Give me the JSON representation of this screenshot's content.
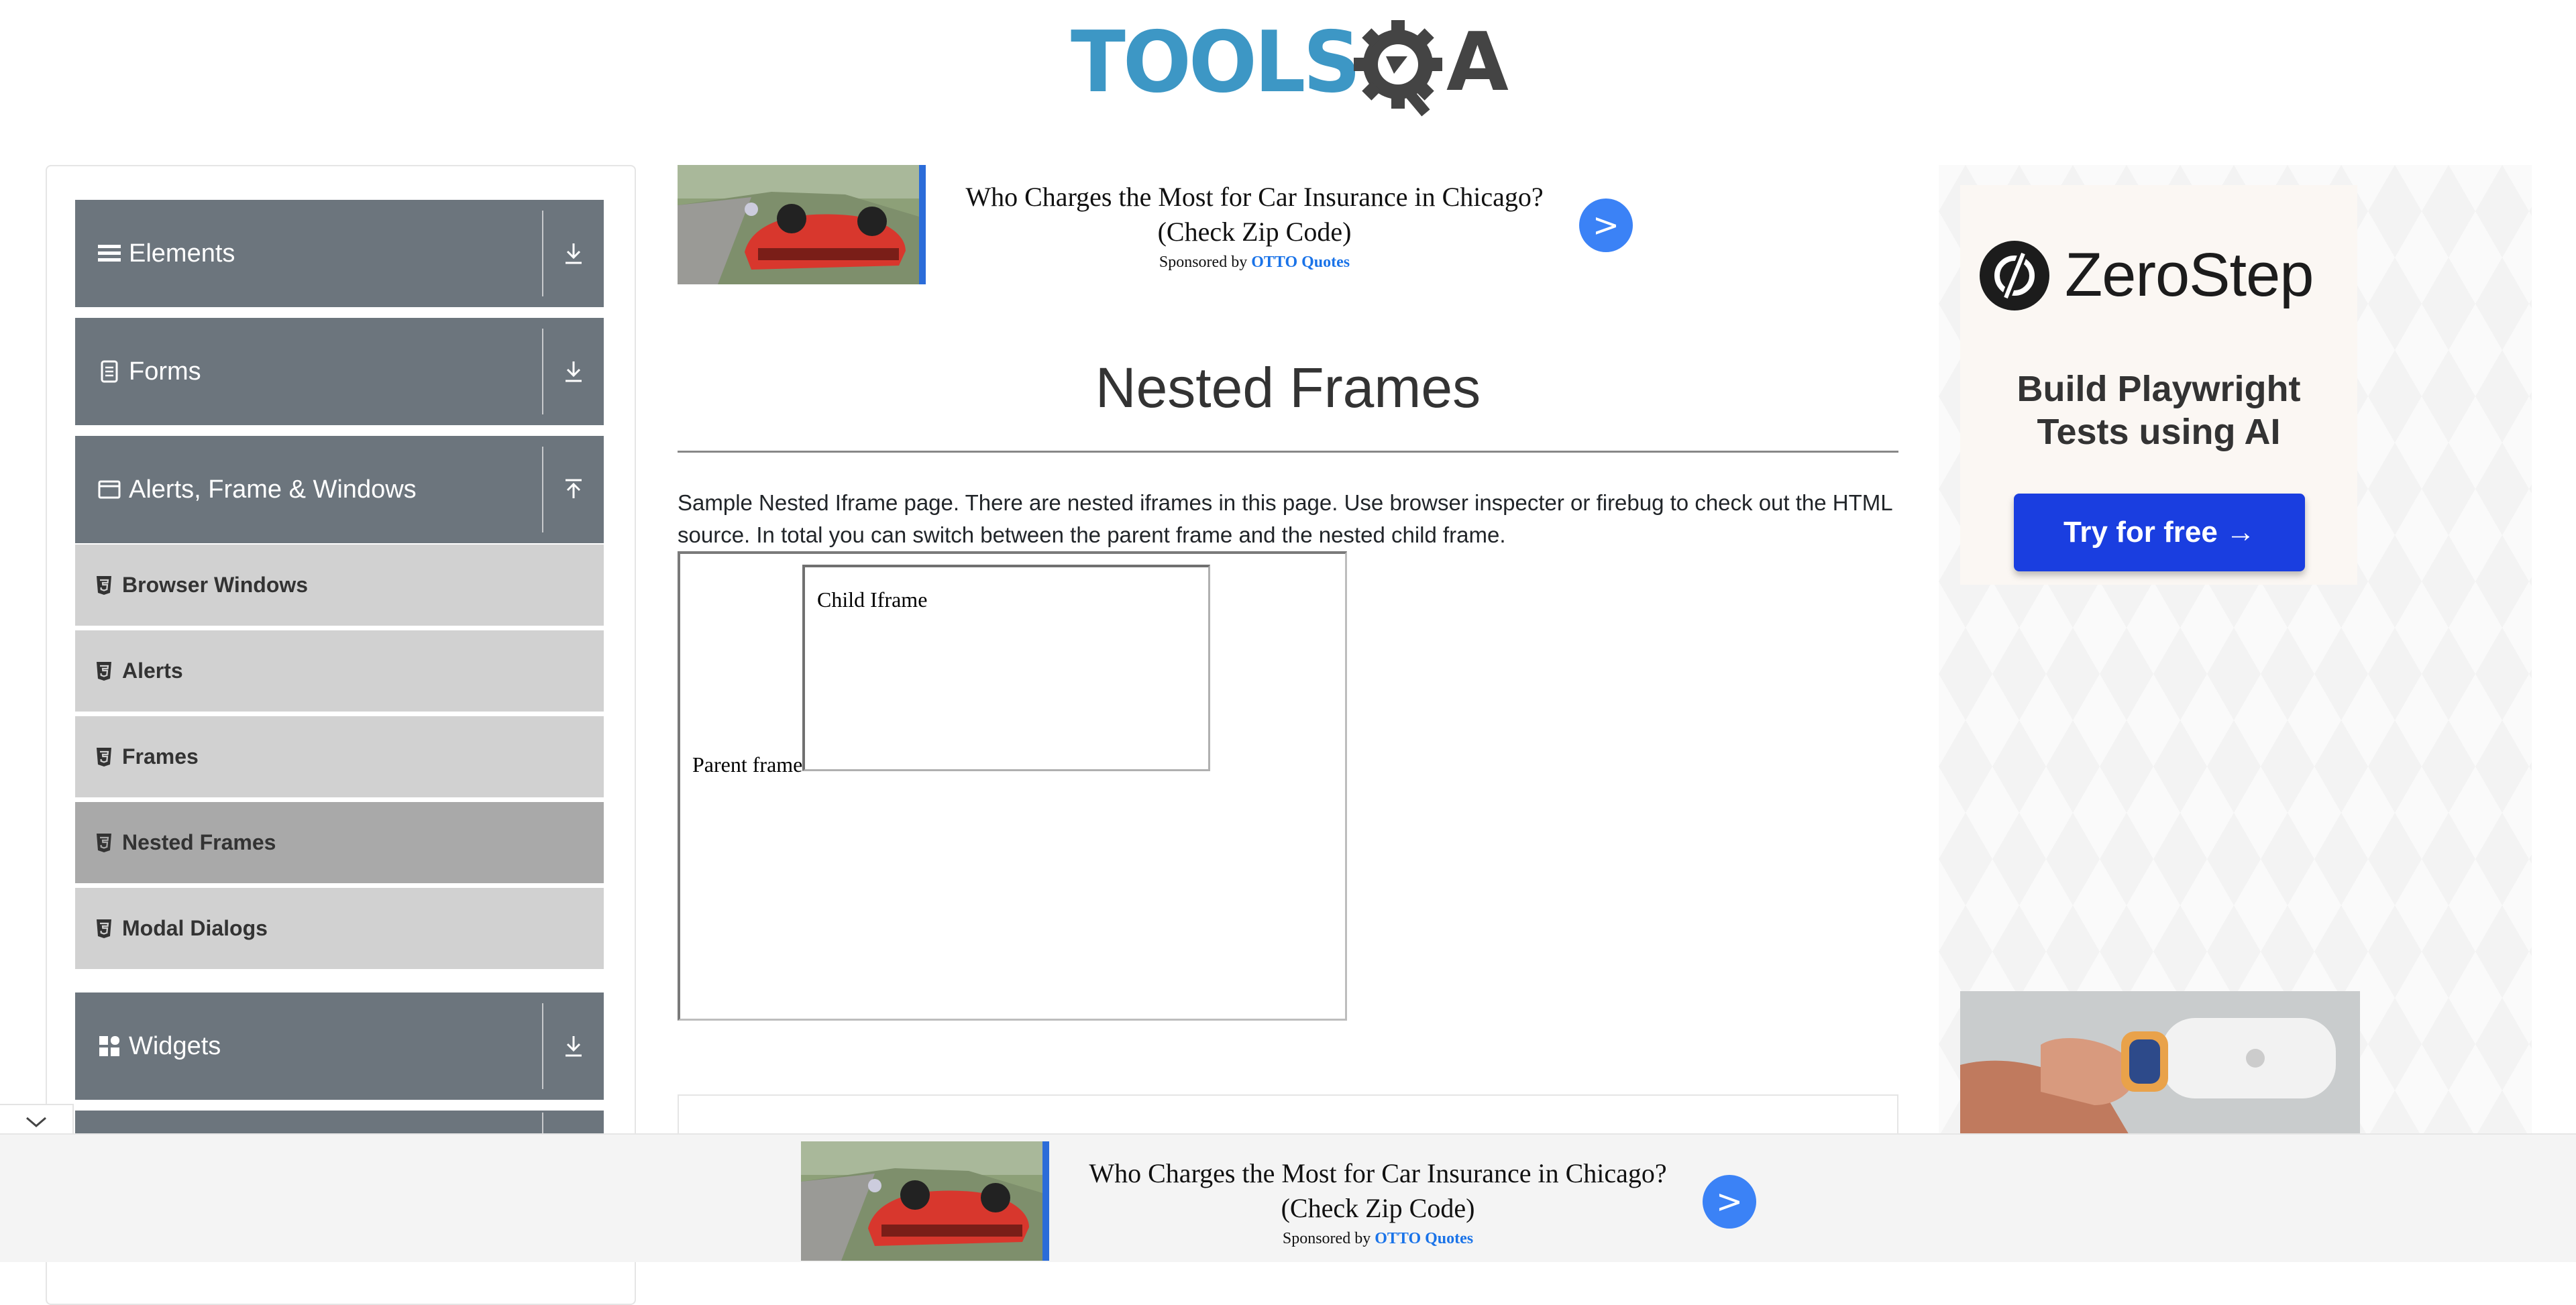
{
  "logo": {
    "brand": "TOOLSQA",
    "text": "TOOLS",
    "letter": "A"
  },
  "sidebar": {
    "groups": [
      {
        "label": "Elements",
        "icon": "hamburger-icon"
      },
      {
        "label": "Forms",
        "icon": "document-icon"
      },
      {
        "label": "Alerts, Frame & Windows",
        "icon": "window-icon",
        "expanded": true,
        "items": [
          {
            "label": "Browser Windows"
          },
          {
            "label": "Alerts"
          },
          {
            "label": "Frames"
          },
          {
            "label": "Nested Frames",
            "active": true
          },
          {
            "label": "Modal Dialogs"
          }
        ]
      },
      {
        "label": "Widgets",
        "icon": "grid-icon"
      }
    ]
  },
  "ad_top": {
    "title_line1": "Who Charges the Most for Car Insurance in Chicago?",
    "title_line2": "(Check Zip Code)",
    "sponsored_prefix": "Sponsored by ",
    "sponsor": "OTTO Quotes",
    "go": ">"
  },
  "main": {
    "title": "Nested Frames",
    "description": "Sample Nested Iframe page. There are nested iframes in this page. Use browser inspecter or firebug to check out the HTML source. In total you can switch between the parent frame and the nested child frame.",
    "parent_frame_label": "Parent frame",
    "child_frame_label": "Child Iframe"
  },
  "right_ad": {
    "brand": "ZeroStep",
    "tagline_line1": "Build Playwright",
    "tagline_line2": "Tests using AI",
    "cta": "Try for free →"
  },
  "ad_bottom": {
    "title_line1": "Who Charges the Most for Car Insurance in Chicago?",
    "title_line2": "(Check Zip Code)",
    "sponsored_prefix": "Sponsored by ",
    "sponsor": "OTTO Quotes",
    "go": ">"
  },
  "colors": {
    "sidebar_group": "#6c757d",
    "sidebar_sub": "#d1d1d1",
    "sidebar_active": "#a9a9a9",
    "accent": "#3b82f6",
    "logo_blue": "#3d97c5",
    "cta_blue": "#1a3ee0"
  }
}
